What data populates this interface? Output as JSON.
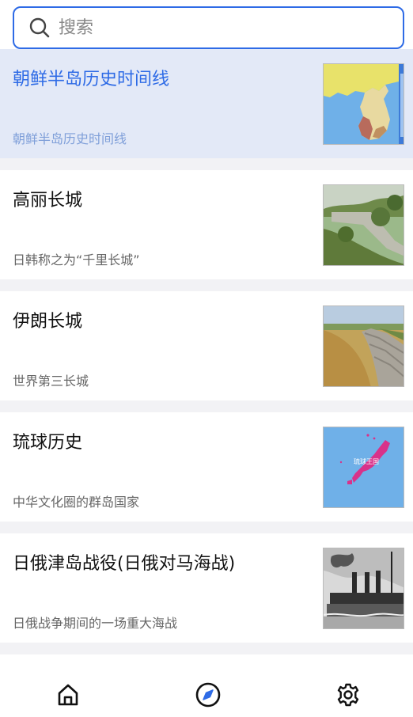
{
  "search": {
    "placeholder": "搜索",
    "value": ""
  },
  "items": [
    {
      "title": "朝鲜半岛历史时间线",
      "subtitle": "朝鲜半岛历史时间线",
      "thumbnail": "korea-map-image",
      "selected": true
    },
    {
      "title": "高丽长城",
      "subtitle": "日韩称之为“千里长城”",
      "thumbnail": "wall-photo-image",
      "selected": false
    },
    {
      "title": "伊朗长城",
      "subtitle": "世界第三长城",
      "thumbnail": "wall-field-image",
      "selected": false
    },
    {
      "title": "琉球历史",
      "subtitle": "中华文化圈的群岛国家",
      "thumbnail": "ryukyu-map-image",
      "selected": false
    },
    {
      "title": "日俄津岛战役(日俄对马海战)",
      "subtitle": "日俄战争期间的一场重大海战",
      "thumbnail": "battleship-photo-image",
      "selected": false
    }
  ],
  "thumb_labels": {
    "ryukyu": "琉球王国"
  },
  "navbar": {
    "home": "home-icon",
    "explore": "compass-icon",
    "settings": "gear-icon"
  },
  "colors": {
    "accent": "#2e6be6",
    "selected_bg": "#e3e9f7",
    "background": "#f2f2f5"
  }
}
